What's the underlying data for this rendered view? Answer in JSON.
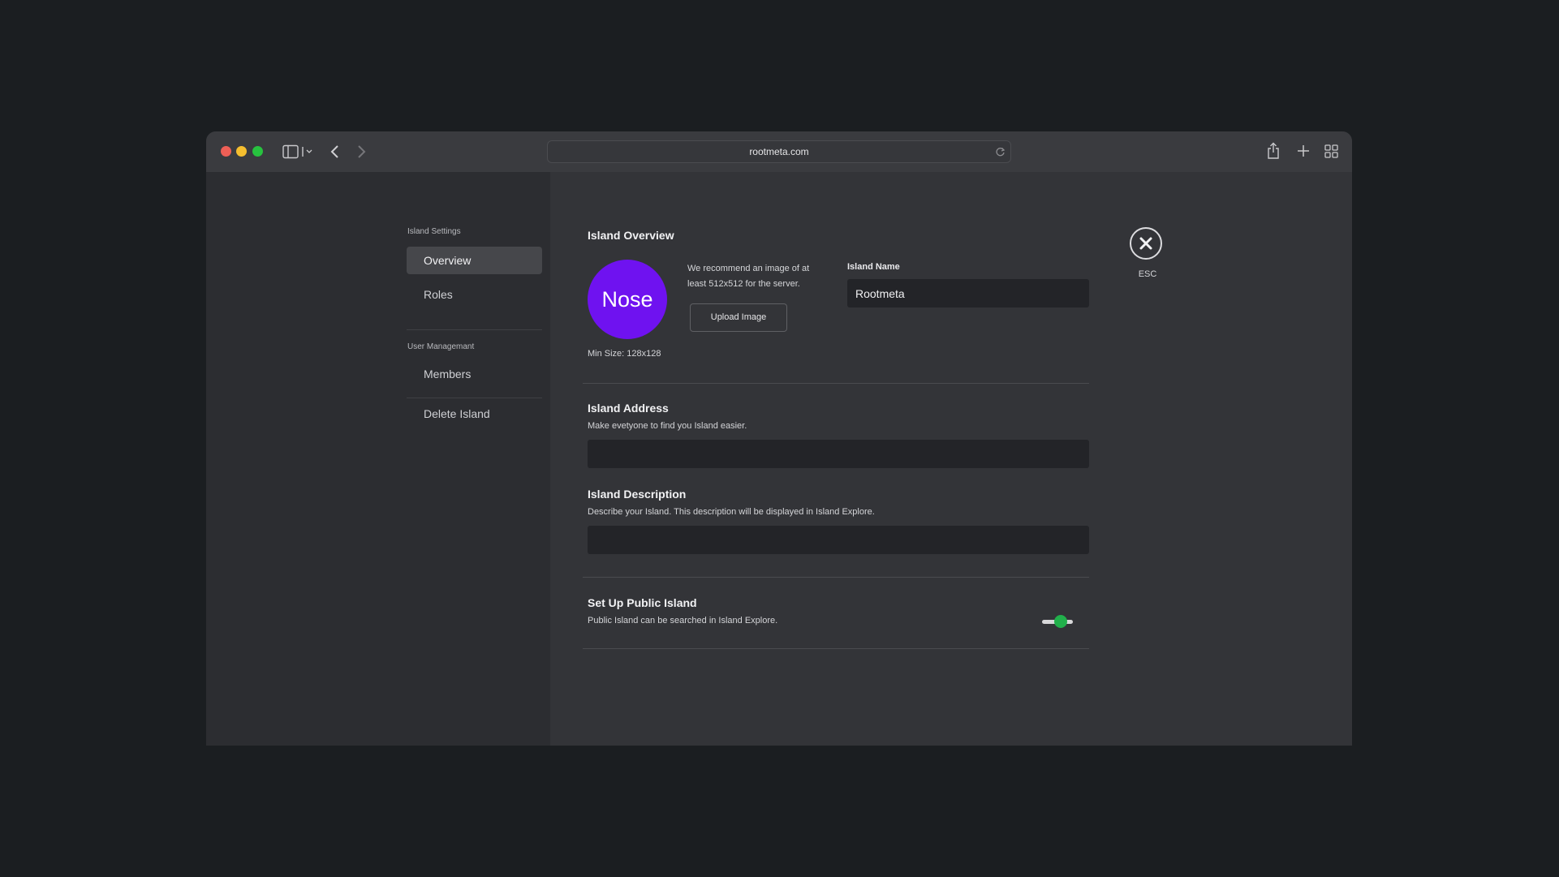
{
  "browser": {
    "url": "rootmeta.com"
  },
  "sidebar": {
    "section_settings": "Island Settings",
    "items_settings": [
      {
        "label": "Overview",
        "active": true
      },
      {
        "label": "Roles",
        "active": false
      }
    ],
    "section_user": "User Managemant",
    "items_user": [
      {
        "label": "Members"
      },
      {
        "label": "Delete Island"
      }
    ]
  },
  "overview": {
    "title": "Island Overview",
    "avatar_text": "Nose",
    "avatar_color": "#6f12f0",
    "recommendation": "We recommend an image of at least 512x512 for the server.",
    "upload_label": "Upload Image",
    "min_size": "Min Size: 128x128",
    "name_label": "Island Name",
    "name_value": "Rootmeta"
  },
  "address": {
    "title": "Island Address",
    "help": "Make evetyone to find you Island easier.",
    "value": ""
  },
  "description": {
    "title": "Island Description",
    "help": "Describe your Island. This description will be displayed in Island Explore.",
    "value": ""
  },
  "public": {
    "title": "Set Up Public Island",
    "help": "Public Island can be searched in Island Explore.",
    "enabled": true,
    "accent": "#21b04b"
  },
  "close": {
    "label": "ESC"
  }
}
